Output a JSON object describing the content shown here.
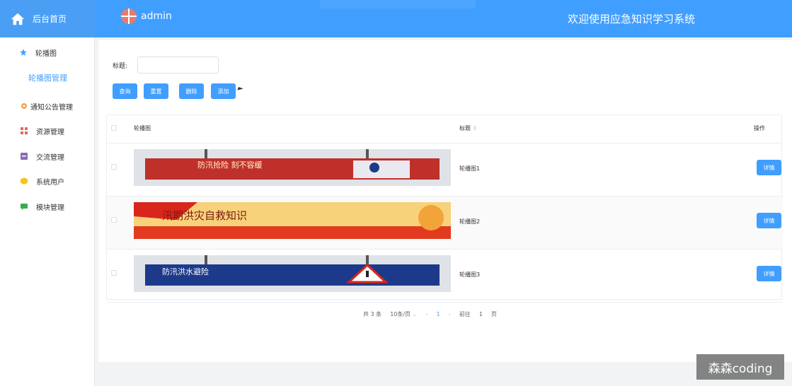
{
  "header": {
    "logo_label": "后台首页",
    "username": "admin",
    "system_title": "欢迎使用应急知识学习系统"
  },
  "sidebar": {
    "items": [
      {
        "label": "轮播图",
        "icon": "star-icon",
        "color": "#409eff"
      },
      {
        "label": "轮播图管理",
        "sub": true
      },
      {
        "label": "通知公告管理",
        "icon": "gear-icon",
        "color": "#f0a14a"
      },
      {
        "label": "资源管理",
        "icon": "grid-icon",
        "color": "#e86a5a"
      },
      {
        "label": "交流管理",
        "icon": "box-icon",
        "color": "#8a6bb8"
      },
      {
        "label": "系统用户",
        "icon": "cube-icon",
        "color": "#f5c518"
      },
      {
        "label": "模块管理",
        "icon": "chat-icon",
        "color": "#3aaa55"
      }
    ]
  },
  "search": {
    "label": "标题:",
    "value": ""
  },
  "buttons": {
    "query": "查询",
    "reset": "重置",
    "delete": "删除",
    "add": "添加"
  },
  "table": {
    "col_image": "轮播图",
    "col_title": "标题",
    "col_ops": "操作",
    "detail_label": "详情",
    "rows": [
      {
        "title": "轮播图1",
        "banner_text": "防汛抢险  刻不容缓",
        "bg": "#c0302a",
        "fg": "#fff4d0"
      },
      {
        "title": "轮播图2",
        "banner_text": "汛期洪灾自救知识",
        "bg": "#e94a2a",
        "fg": "#7a1a10"
      },
      {
        "title": "轮播图3",
        "banner_text": "防汛洪水避险",
        "bg": "#1d3a8a",
        "fg": "#ffffff"
      }
    ]
  },
  "pager": {
    "total": "共 3 条",
    "page_size": "10条/页",
    "prev": "‹",
    "page": "1",
    "next": "›",
    "goto": "前往",
    "goto_value": "1",
    "page_unit": "页"
  },
  "watermark": "森森coding"
}
